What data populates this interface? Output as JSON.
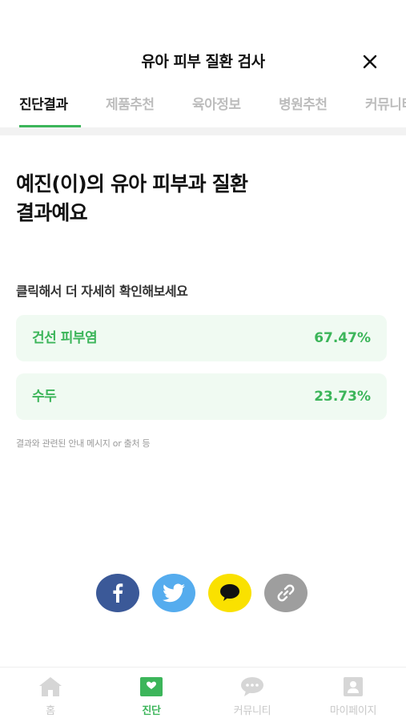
{
  "header": {
    "title": "유아 피부 질환 검사",
    "close_icon": "close-icon"
  },
  "tabs": [
    {
      "label": "진단결과",
      "active": true
    },
    {
      "label": "제품추천",
      "active": false
    },
    {
      "label": "육아정보",
      "active": false
    },
    {
      "label": "병원추천",
      "active": false
    },
    {
      "label": "커뮤니티",
      "active": false
    }
  ],
  "main": {
    "heading_line1": "예진(이)의 유아 피부과 질환",
    "heading_line2": "결과예요",
    "hint": "클릭해서 더 자세히 확인해보세요",
    "results": [
      {
        "label": "건선 피부염",
        "value": "67.47%"
      },
      {
        "label": "수두",
        "value": "23.73%"
      }
    ],
    "note": "결과와 관련된 안내 메시지 or 출처 등"
  },
  "share": {
    "buttons": [
      {
        "icon": "facebook-icon",
        "color": "#3b5998"
      },
      {
        "icon": "twitter-icon",
        "color": "#55acee"
      },
      {
        "icon": "kakaotalk-icon",
        "color": "#fae100"
      },
      {
        "icon": "link-icon",
        "color": "#9e9e9e"
      }
    ]
  },
  "bottom_nav": {
    "items": [
      {
        "label": "홈",
        "icon": "home-icon",
        "active": false
      },
      {
        "label": "진단",
        "icon": "heart-card-icon",
        "active": true
      },
      {
        "label": "커뮤니티",
        "icon": "chat-bubble-icon",
        "active": false
      },
      {
        "label": "마이페이지",
        "icon": "profile-icon",
        "active": false
      }
    ]
  },
  "colors": {
    "accent": "#3cb55a",
    "card_background": "#f0faf2",
    "inactive_text": "#bdbdbd"
  }
}
